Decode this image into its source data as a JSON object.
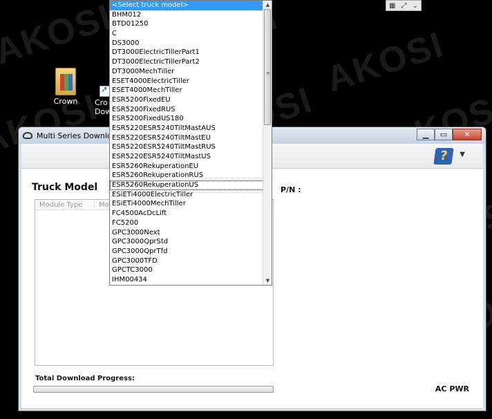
{
  "watermark": "AKOSI",
  "desktop": {
    "icons": [
      {
        "label": "Crown"
      },
      {
        "label": "Cro Dow"
      }
    ]
  },
  "window": {
    "title": "Multi Series Download",
    "truck_model_label": "Truck Model",
    "pn_label": "P/N :",
    "table_headers": [
      "Module Type",
      "Mo"
    ],
    "progress_label": "Total Download Progress:",
    "progress_value": 0,
    "status_text": "AC PWR"
  },
  "dropdown": {
    "selected": "<Select truck model>",
    "items": [
      "<Select truck model>",
      "BHM012",
      "BTD01250",
      "C",
      "DS3000",
      "DT3000ElectricTillerPart1",
      "DT3000ElectricTillerPart2",
      "DT3000MechTiller",
      "ESET4000ElectricTiller",
      "ESET4000MechTiller",
      "ESR5200FixedEU",
      "ESR5200FixedRUS",
      "ESR5200FixedUS180",
      "ESR5220ESR5240TiltMastAUS",
      "ESR5220ESR5240TiltMastEU",
      "ESR5220ESR5240TiltMastRUS",
      "ESR5220ESR5240TiltMastUS",
      "ESR5260RekuperationEU",
      "ESR5260RekuperationRUS",
      "ESR5260RekuperationUS",
      "ESiETi4000ElectricTiller",
      "ESiETi4000MechTiller",
      "FC4500AcDcLift",
      "FC5200",
      "GPC3000Next",
      "GPC3000QprStd",
      "GPC3000QprTfd",
      "GPC3000TFD",
      "GPCTC3000",
      "IHM00434"
    ],
    "focused_index": 19
  }
}
